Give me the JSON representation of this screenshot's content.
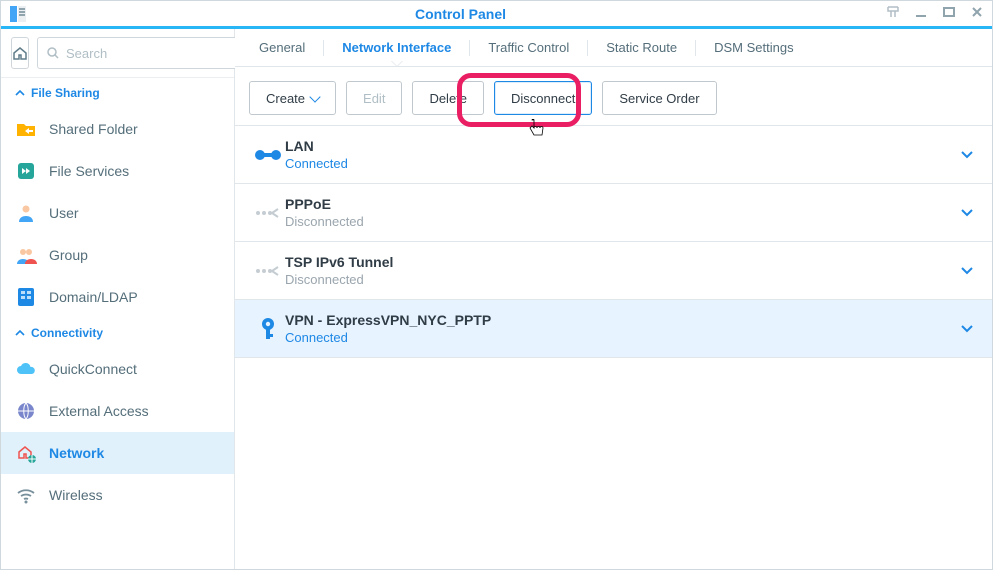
{
  "window": {
    "title": "Control Panel"
  },
  "search": {
    "placeholder": "Search",
    "value": ""
  },
  "sections": {
    "file_sharing": {
      "label": "File Sharing"
    },
    "connectivity": {
      "label": "Connectivity"
    }
  },
  "sidebar": {
    "file_sharing_items": [
      {
        "label": "Shared Folder"
      },
      {
        "label": "File Services"
      },
      {
        "label": "User"
      },
      {
        "label": "Group"
      },
      {
        "label": "Domain/LDAP"
      }
    ],
    "connectivity_items": [
      {
        "label": "QuickConnect"
      },
      {
        "label": "External Access"
      },
      {
        "label": "Network"
      },
      {
        "label": "Wireless"
      }
    ]
  },
  "tabs": {
    "general": "General",
    "network_interface": "Network Interface",
    "traffic_control": "Traffic Control",
    "static_route": "Static Route",
    "dsm_settings": "DSM Settings"
  },
  "toolbar": {
    "create": "Create",
    "edit": "Edit",
    "delete": "Delete",
    "disconnect": "Disconnect",
    "service_order": "Service Order"
  },
  "interfaces": [
    {
      "name": "LAN",
      "status": "Connected",
      "state": "connected",
      "selected": false,
      "icon": "lan-connected"
    },
    {
      "name": "PPPoE",
      "status": "Disconnected",
      "state": "disconnected",
      "selected": false,
      "icon": "route-disconnected"
    },
    {
      "name": "TSP IPv6 Tunnel",
      "status": "Disconnected",
      "state": "disconnected",
      "selected": false,
      "icon": "route-disconnected"
    },
    {
      "name": "VPN - ExpressVPN_NYC_PPTP",
      "status": "Connected",
      "state": "connected",
      "selected": true,
      "icon": "vpn-key"
    }
  ]
}
